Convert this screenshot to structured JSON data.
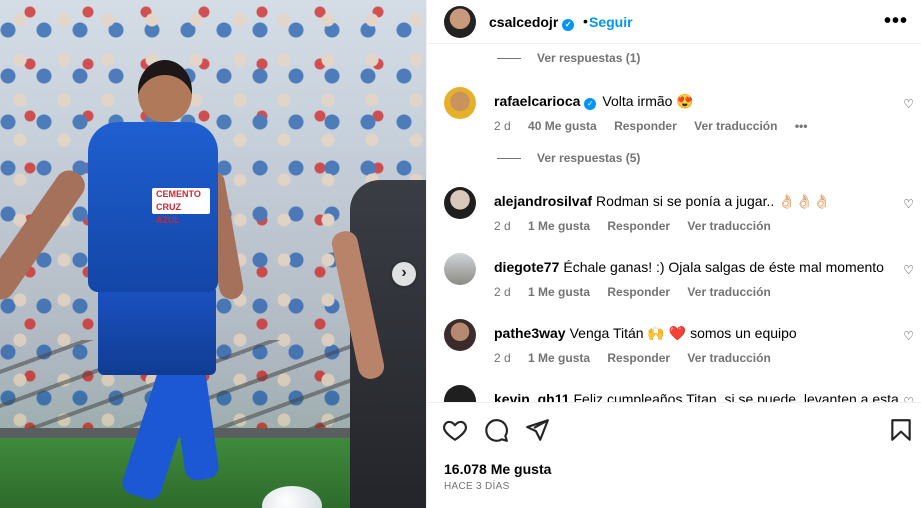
{
  "post": {
    "author": "csalcedojr",
    "follow_label": "Seguir",
    "separator": "•",
    "more": "•••"
  },
  "photo": {
    "sponsor_text": "CEMENTO CRUZ AZUL",
    "next": "›"
  },
  "comments": {
    "top_view_replies": "Ver respuestas (1)",
    "mid_view_replies": "Ver respuestas (5)",
    "items": [
      {
        "user": "rafaelcarioca",
        "verified": true,
        "text": "Volta irmão 😍",
        "age": "2 d",
        "likes": "40 Me gusta",
        "reply": "Responder",
        "translate": "Ver traducción",
        "more": "•••"
      },
      {
        "user": "alejandrosilvaf",
        "verified": false,
        "text": "Rodman si se ponía a jugar.. 👌🏻👌🏻👌🏻",
        "age": "2 d",
        "likes": "1 Me gusta",
        "reply": "Responder",
        "translate": "Ver traducción"
      },
      {
        "user": "diegote77",
        "verified": false,
        "text": "Échale ganas! :) Ojala salgas de éste mal momento",
        "age": "2 d",
        "likes": "1 Me gusta",
        "reply": "Responder",
        "translate": "Ver traducción"
      },
      {
        "user": "pathe3way",
        "verified": false,
        "text": "Venga Titán 🙌 ❤️ somos un equipo",
        "age": "2 d",
        "likes": "1 Me gusta",
        "reply": "Responder",
        "translate": "Ver traducción"
      },
      {
        "user": "kevin_gh11",
        "verified": false,
        "text": "Feliz cumpleaños Titan, si se puede, levanten a esta",
        "age": "",
        "likes": "",
        "reply": "",
        "translate": ""
      }
    ]
  },
  "actions": {
    "likes": "16.078 Me gusta",
    "time": "HACE 3 DÍAS"
  },
  "colors": {
    "accent": "#0095f6",
    "muted": "#737373",
    "heart": "#ed4956"
  }
}
